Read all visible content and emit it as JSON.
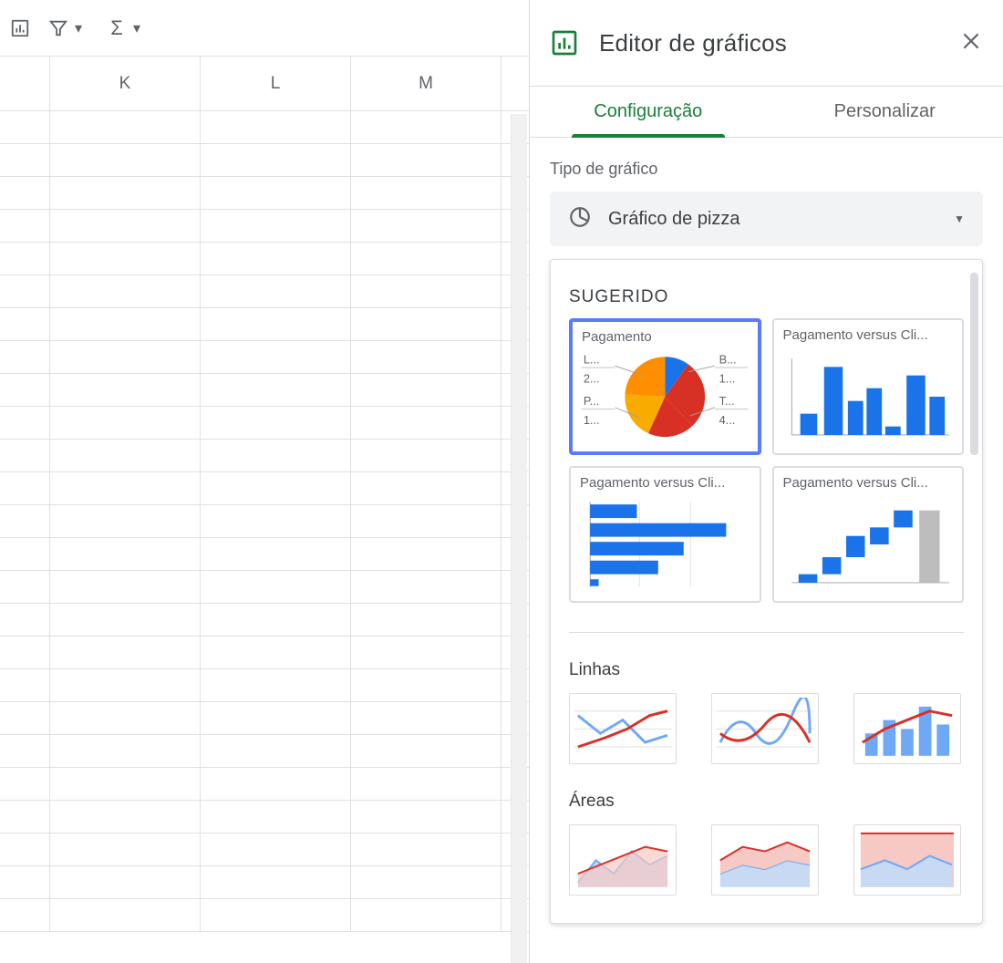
{
  "toolbar": {
    "collapse": ""
  },
  "columns": {
    "k": "K",
    "l": "L",
    "m": "M"
  },
  "panel": {
    "title": "Editor de gráficos",
    "tabs": {
      "setup": "Configuração",
      "customize": "Personalizar"
    },
    "chart_type_label": "Tipo de gráfico",
    "chart_type_value": "Gráfico de pizza",
    "suggested_label": "SUGERIDO",
    "lines_label": "Linhas",
    "areas_label": "Áreas",
    "sugg": {
      "pie_title": "Pagamento",
      "pie_legend": {
        "l": "L...",
        "lval": "2...",
        "p": "P...",
        "pval": "1...",
        "b": "B...",
        "bval": "1...",
        "t": "T...",
        "tval": "4..."
      },
      "bar_title": "Pagamento versus Cli...",
      "hbar_title": "Pagamento versus Cli...",
      "step_title": "Pagamento versus Cli..."
    }
  },
  "chart_data": {
    "type": "pie",
    "title": "Pagamento",
    "categories": [
      "L...",
      "B...",
      "T...",
      "P..."
    ],
    "values": [
      2,
      1,
      4,
      1
    ],
    "colors": [
      "#f9ab00",
      "#1a73e8",
      "#d93025",
      "#f29900"
    ]
  }
}
